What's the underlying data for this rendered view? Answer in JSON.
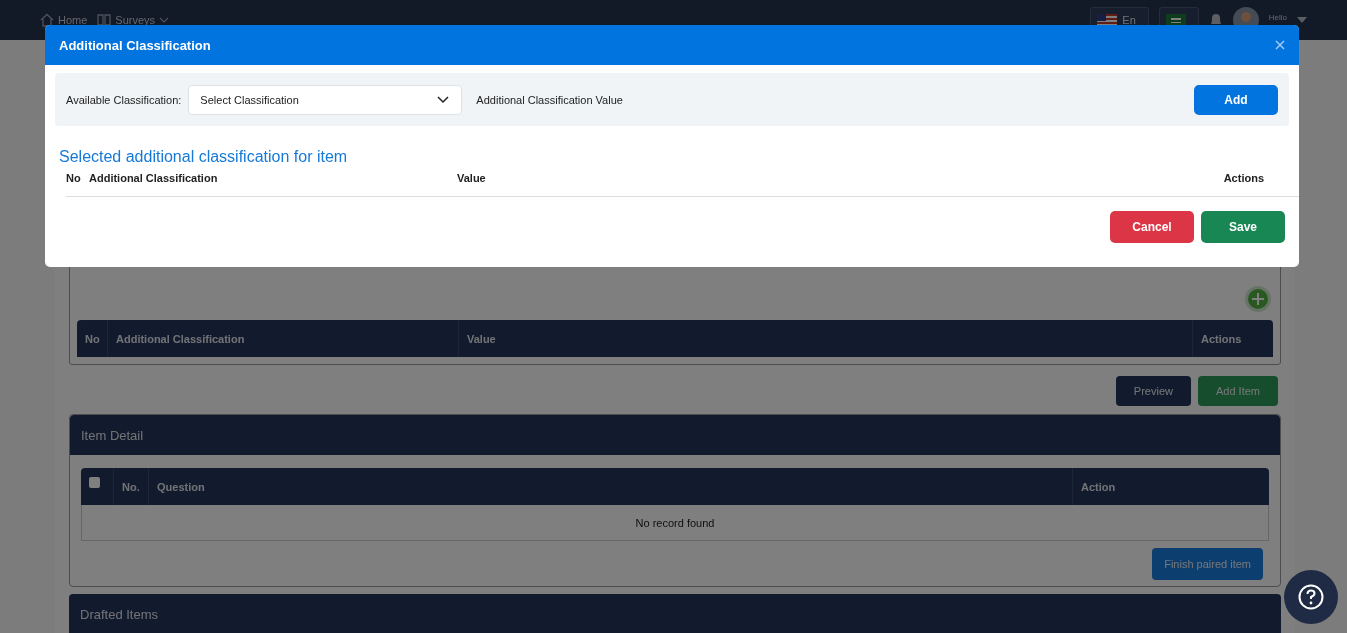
{
  "navbar": {
    "links": [
      {
        "label": "Home",
        "kind": "home"
      },
      {
        "label": "Surveys",
        "kind": "menu"
      }
    ],
    "languages": [
      {
        "label": "En",
        "kind": "us"
      },
      {
        "kind": "sa"
      }
    ],
    "user": {
      "greeting": "Hello"
    }
  },
  "page": {
    "classification_table": {
      "columns": [
        "No",
        "Additional Classification",
        "Value",
        "Actions"
      ]
    },
    "buttons": [
      {
        "label": "Preview",
        "kind": "dark"
      },
      {
        "label": "Add Item",
        "kind": "green"
      }
    ],
    "item_detail": {
      "title": "Item Detail",
      "header_checkbox": {
        "checked": false
      },
      "columns": [
        "No.",
        "Question",
        "Action"
      ],
      "empty": "No record found",
      "button": "Finish paired item"
    },
    "drafted_items": {
      "title": "Drafted Items"
    }
  },
  "modal": {
    "title": "Additional Classification",
    "form": {
      "label": "Available Classification:",
      "select_value": "Select Classification",
      "value_label": "Additional Classification Value",
      "add_button": "Add"
    },
    "section_title": "Selected additional classification for item",
    "columns": [
      "No",
      "Additional Classification",
      "Value",
      "Actions"
    ],
    "buttons": [
      {
        "label": "Cancel",
        "kind": "danger"
      },
      {
        "label": "Save",
        "kind": "success"
      }
    ]
  }
}
